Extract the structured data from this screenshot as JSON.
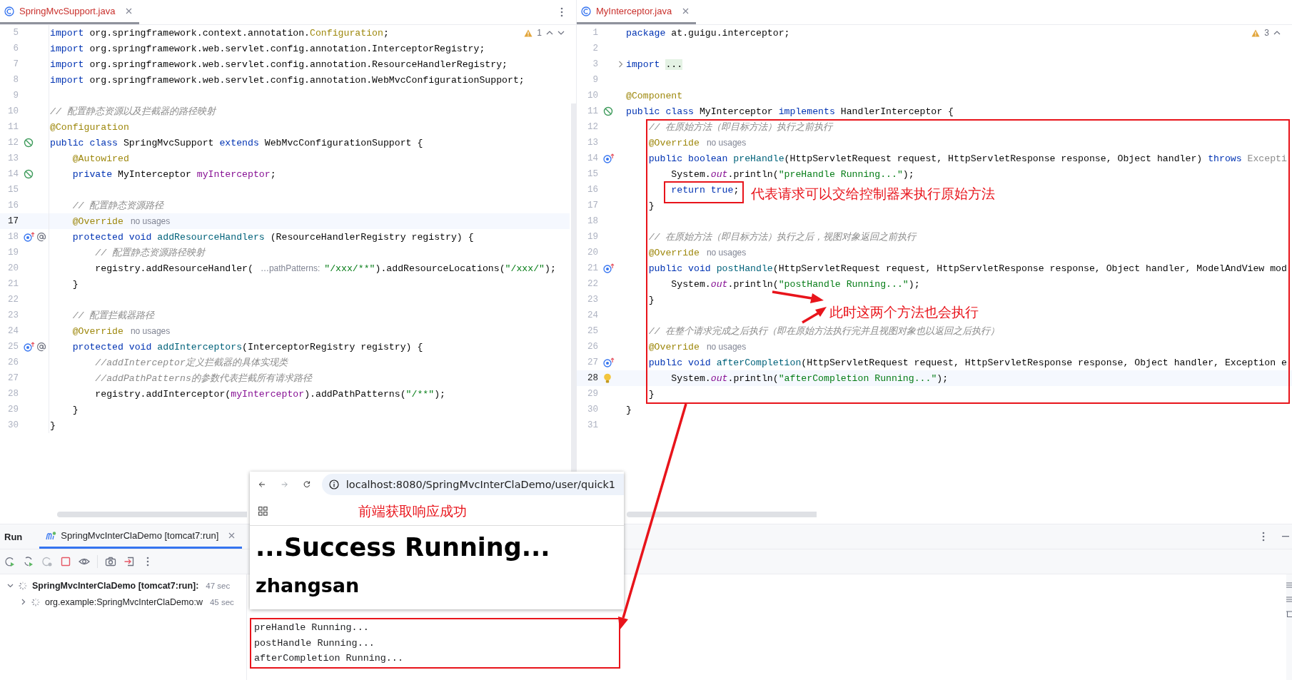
{
  "editors": [
    {
      "tab": {
        "label": "SpringMvcSupport.java",
        "selected": true
      },
      "warnings": "1",
      "lines": [
        {
          "num": "5",
          "current": false,
          "tokens": [
            {
              "kind": "kw",
              "text": "import"
            },
            {
              "kind": "plain",
              "text": " org.springframework.context.annotation."
            },
            {
              "kind": "ann",
              "text": "Configuration"
            },
            {
              "kind": "plain",
              "text": ";"
            }
          ]
        },
        {
          "num": "6",
          "current": false,
          "tokens": [
            {
              "kind": "kw",
              "text": "import"
            },
            {
              "kind": "plain",
              "text": " org.springframework.web.servlet.config.annotation.InterceptorRegistry;"
            }
          ]
        },
        {
          "num": "7",
          "current": false,
          "tokens": [
            {
              "kind": "kw",
              "text": "import"
            },
            {
              "kind": "plain",
              "text": " org.springframework.web.servlet.config.annotation.ResourceHandlerRegistry;"
            }
          ]
        },
        {
          "num": "8",
          "current": false,
          "tokens": [
            {
              "kind": "kw",
              "text": "import"
            },
            {
              "kind": "plain",
              "text": " org.springframework.web.servlet.config.annotation.WebMvcConfigurationSupport;"
            }
          ]
        },
        {
          "num": "9",
          "current": false
        },
        {
          "num": "10",
          "current": false,
          "tokens": [
            {
              "kind": "cmt",
              "text": "// 配置静态资源以及拦截器的路径映射"
            }
          ]
        },
        {
          "num": "11",
          "current": false,
          "tokens": [
            {
              "kind": "ann",
              "text": "@Configuration"
            }
          ]
        },
        {
          "num": "12",
          "current": false,
          "gutter_icons": [
            {
              "kind": "bean"
            }
          ],
          "tokens": [
            {
              "kind": "kw",
              "text": "public class"
            },
            {
              "kind": "plain",
              "text": " SpringMvcSupport "
            },
            {
              "kind": "kw",
              "text": "extends"
            },
            {
              "kind": "plain",
              "text": " WebMvcConfigurationSupport {"
            }
          ]
        },
        {
          "num": "13",
          "current": false,
          "tokens": [
            {
              "kind": "ann",
              "text": "    @Autowired"
            }
          ]
        },
        {
          "num": "14",
          "current": false,
          "gutter_icons": [
            {
              "kind": "bean"
            }
          ],
          "tokens": [
            {
              "kind": "kw",
              "text": "    private"
            },
            {
              "kind": "plain",
              "text": " MyInterceptor "
            },
            {
              "kind": "fld",
              "text": "myInterceptor"
            },
            {
              "kind": "plain",
              "text": ";"
            }
          ]
        },
        {
          "num": "15",
          "current": false
        },
        {
          "num": "16",
          "current": false,
          "tokens": [
            {
              "kind": "cmt",
              "text": "    // 配置静态资源路径"
            }
          ]
        },
        {
          "num": "17",
          "current": true,
          "tokens": [
            {
              "kind": "ann",
              "text": "    @Override"
            },
            {
              "kind": "hint",
              "text": "no usages"
            }
          ]
        },
        {
          "num": "18",
          "current": false,
          "gutter_icons": [
            {
              "kind": "override"
            },
            {
              "kind": "at"
            }
          ],
          "tokens": [
            {
              "kind": "kw",
              "text": "    protected void"
            },
            {
              "kind": "fn",
              "text": " addResourceHandlers"
            },
            {
              "kind": "plain",
              "text": " (ResourceHandlerRegistry registry) {"
            }
          ]
        },
        {
          "num": "19",
          "current": false,
          "tokens": [
            {
              "kind": "cmt",
              "text": "        // 配置静态资源路径映射"
            }
          ]
        },
        {
          "num": "20",
          "current": false,
          "tokens": [
            {
              "kind": "plain",
              "text": "        registry.addResourceHandler("
            },
            {
              "kind": "hint",
              "text": "…pathPatterns:"
            },
            {
              "kind": "str",
              "text": "\"/xxx/**\""
            },
            {
              "kind": "plain",
              "text": ").addResourceLocations("
            },
            {
              "kind": "str",
              "text": "\"/xxx/\""
            },
            {
              "kind": "plain",
              "text": ");"
            }
          ]
        },
        {
          "num": "21",
          "current": false,
          "tokens": [
            {
              "kind": "plain",
              "text": "    }"
            }
          ]
        },
        {
          "num": "22",
          "current": false
        },
        {
          "num": "23",
          "current": false,
          "tokens": [
            {
              "kind": "cmt",
              "text": "    // 配置拦截器路径"
            }
          ]
        },
        {
          "num": "24",
          "current": false,
          "tokens": [
            {
              "kind": "ann",
              "text": "    @Override"
            },
            {
              "kind": "hint",
              "text": "no usages"
            }
          ]
        },
        {
          "num": "25",
          "current": false,
          "gutter_icons": [
            {
              "kind": "override"
            },
            {
              "kind": "at"
            }
          ],
          "tokens": [
            {
              "kind": "kw",
              "text": "    protected void"
            },
            {
              "kind": "fn",
              "text": " addInterceptors"
            },
            {
              "kind": "plain",
              "text": "(InterceptorRegistry registry) {"
            }
          ]
        },
        {
          "num": "26",
          "current": false,
          "tokens": [
            {
              "kind": "cmt",
              "text": "        //addInterceptor定义拦截器的具体实现类"
            }
          ]
        },
        {
          "num": "27",
          "current": false,
          "tokens": [
            {
              "kind": "cmt",
              "text": "        //addPathPatterns的参数代表拦截所有请求路径"
            }
          ]
        },
        {
          "num": "28",
          "current": false,
          "tokens": [
            {
              "kind": "plain",
              "text": "        registry.addInterceptor("
            },
            {
              "kind": "fld",
              "text": "myInterceptor"
            },
            {
              "kind": "plain",
              "text": ").addPathPatterns("
            },
            {
              "kind": "str",
              "text": "\"/**\""
            },
            {
              "kind": "plain",
              "text": ");"
            }
          ]
        },
        {
          "num": "29",
          "current": false,
          "tokens": [
            {
              "kind": "plain",
              "text": "    }"
            }
          ]
        },
        {
          "num": "30",
          "current": false,
          "tokens": [
            {
              "kind": "plain",
              "text": "}"
            }
          ]
        }
      ]
    },
    {
      "tab": {
        "label": "MyInterceptor.java",
        "selected": true
      },
      "warnings": "3",
      "lines": [
        {
          "num": "1",
          "current": false,
          "tokens": [
            {
              "kind": "kw",
              "text": "package"
            },
            {
              "kind": "plain",
              "text": " at.guigu.interceptor;"
            }
          ]
        },
        {
          "num": "2",
          "current": false
        },
        {
          "num": "3",
          "current": false,
          "gutter_icons": [
            {
              "kind": "fold"
            }
          ],
          "tokens": [
            {
              "kind": "kw",
              "text": "import"
            },
            {
              "kind": "fold",
              "text": "..."
            }
          ]
        },
        {
          "num": "9",
          "current": false
        },
        {
          "num": "10",
          "current": false,
          "tokens": [
            {
              "kind": "ann",
              "text": "@Component"
            }
          ]
        },
        {
          "num": "11",
          "current": false,
          "gutter_icons": [
            {
              "kind": "bean"
            }
          ],
          "tokens": [
            {
              "kind": "kw",
              "text": "public class"
            },
            {
              "kind": "plain",
              "text": " MyInterceptor "
            },
            {
              "kind": "kw",
              "text": "implements"
            },
            {
              "kind": "plain",
              "text": " HandlerInterceptor {"
            }
          ]
        },
        {
          "num": "12",
          "current": false,
          "tokens": [
            {
              "kind": "cmt",
              "text": "    // 在原始方法（即目标方法）执行之前执行"
            }
          ]
        },
        {
          "num": "13",
          "current": false,
          "tokens": [
            {
              "kind": "ann",
              "text": "    @Override"
            },
            {
              "kind": "hint",
              "text": "no usages"
            }
          ]
        },
        {
          "num": "14",
          "current": false,
          "gutter_icons": [
            {
              "kind": "override"
            }
          ],
          "tokens": [
            {
              "kind": "kw",
              "text": "    public boolean"
            },
            {
              "kind": "fn",
              "text": " preHandle"
            },
            {
              "kind": "plain",
              "text": "(HttpServletRequest request, HttpServletResponse response, Object handler) "
            },
            {
              "kind": "kw",
              "text": "throws"
            },
            {
              "kind": "dim",
              "text": " Excepti"
            }
          ]
        },
        {
          "num": "15",
          "current": false,
          "tokens": [
            {
              "kind": "plain",
              "text": "        System."
            },
            {
              "kind": "static",
              "text": "out"
            },
            {
              "kind": "plain",
              "text": ".println("
            },
            {
              "kind": "str",
              "text": "\"preHandle Running...\""
            },
            {
              "kind": "plain",
              "text": ");"
            }
          ]
        },
        {
          "num": "16",
          "current": false,
          "tokens": [
            {
              "kind": "kw",
              "text": "        return true"
            },
            {
              "kind": "plain",
              "text": ";"
            }
          ]
        },
        {
          "num": "17",
          "current": false,
          "tokens": [
            {
              "kind": "plain",
              "text": "    }"
            }
          ]
        },
        {
          "num": "18",
          "current": false
        },
        {
          "num": "19",
          "current": false,
          "tokens": [
            {
              "kind": "cmt",
              "text": "    // 在原始方法（即目标方法）执行之后，视图对象返回之前执行"
            }
          ]
        },
        {
          "num": "20",
          "current": false,
          "tokens": [
            {
              "kind": "ann",
              "text": "    @Override"
            },
            {
              "kind": "hint",
              "text": "no usages"
            }
          ]
        },
        {
          "num": "21",
          "current": false,
          "gutter_icons": [
            {
              "kind": "override"
            }
          ],
          "tokens": [
            {
              "kind": "kw",
              "text": "    public void"
            },
            {
              "kind": "fn",
              "text": " postHandle"
            },
            {
              "kind": "plain",
              "text": "(HttpServletRequest request, HttpServletResponse response, Object handler, ModelAndView mod"
            }
          ]
        },
        {
          "num": "22",
          "current": false,
          "tokens": [
            {
              "kind": "plain",
              "text": "        System."
            },
            {
              "kind": "static",
              "text": "out"
            },
            {
              "kind": "plain",
              "text": ".println("
            },
            {
              "kind": "str",
              "text": "\"postHandle Running...\""
            },
            {
              "kind": "plain",
              "text": ");"
            }
          ]
        },
        {
          "num": "23",
          "current": false,
          "tokens": [
            {
              "kind": "plain",
              "text": "    }"
            }
          ]
        },
        {
          "num": "24",
          "current": false
        },
        {
          "num": "25",
          "current": false,
          "tokens": [
            {
              "kind": "cmt",
              "text": "    // 在整个请求完成之后执行（即在原始方法执行完并且视图对象也以返回之后执行）"
            }
          ]
        },
        {
          "num": "26",
          "current": false,
          "tokens": [
            {
              "kind": "ann",
              "text": "    @Override"
            },
            {
              "kind": "hint",
              "text": "no usages"
            }
          ]
        },
        {
          "num": "27",
          "current": false,
          "gutter_icons": [
            {
              "kind": "override"
            }
          ],
          "tokens": [
            {
              "kind": "kw",
              "text": "    public void"
            },
            {
              "kind": "fn",
              "text": " afterCompletion"
            },
            {
              "kind": "plain",
              "text": "(HttpServletRequest request, HttpServletResponse response, Object handler, Exception e"
            }
          ]
        },
        {
          "num": "28",
          "current": true,
          "gutter_icons": [
            {
              "kind": "bulb"
            }
          ],
          "tokens": [
            {
              "kind": "plain",
              "text": "        System."
            },
            {
              "kind": "static",
              "text": "out"
            },
            {
              "kind": "plain",
              "text": ".println("
            },
            {
              "kind": "str",
              "text": "\"afterCompletion Running...\""
            },
            {
              "kind": "plain",
              "text": ");"
            }
          ]
        },
        {
          "num": "29",
          "current": false,
          "tokens": [
            {
              "kind": "plain",
              "text": "    }"
            }
          ]
        },
        {
          "num": "30",
          "current": false,
          "tokens": [
            {
              "kind": "plain",
              "text": "}"
            }
          ]
        },
        {
          "num": "31",
          "current": false
        }
      ]
    }
  ],
  "run_panel": {
    "title": "Run",
    "tab": {
      "label": "SpringMvcInterClaDemo [tomcat7:run]",
      "selected": true
    },
    "toolbar": [
      {
        "kind": "rerun",
        "disabled": false
      },
      {
        "kind": "rerun-failed",
        "disabled": false
      },
      {
        "kind": "restart",
        "disabled": true
      },
      {
        "kind": "stop",
        "disabled": false
      },
      {
        "kind": "view",
        "disabled": false
      },
      {
        "kind": "camera",
        "disabled": false
      },
      {
        "kind": "exit",
        "disabled": false
      },
      {
        "kind": "more",
        "disabled": false
      }
    ],
    "tree": [
      {
        "label": "SpringMvcInterClaDemo [tomcat7:run]:",
        "time": "47 sec",
        "expanded": true,
        "children": [
          {
            "label": "org.example:SpringMvcInterClaDemo:w",
            "time": "45 sec",
            "expanded": false
          }
        ]
      }
    ],
    "console": [
      {
        "text": "preHandle Running..."
      },
      {
        "text": "postHandle Running..."
      },
      {
        "text": "afterCompletion Running..."
      }
    ]
  },
  "browser": {
    "url": "localhost:8080/SpringMvcInterClaDemo/user/quick1",
    "forward_disabled": true,
    "heading": "...Success Running...",
    "subheading": "zhangsan"
  },
  "annotations": [
    {
      "text": "代表请求可以交给控制器来执行原始方法"
    },
    {
      "text": "此时这两个方法也会执行"
    },
    {
      "text": "前端获取响应成功"
    }
  ]
}
